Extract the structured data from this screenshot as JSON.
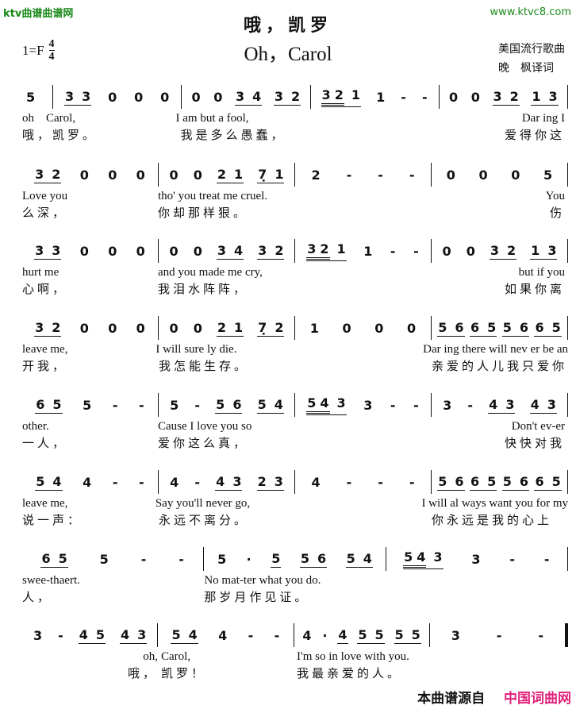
{
  "watermark": {
    "left": "ktv曲谱曲谱网",
    "right": "www.ktvc8.com",
    "color": "#1a8a1a"
  },
  "header": {
    "title_zh": "哦，凯罗",
    "title_en": "Oh，Carol",
    "key": "1=F",
    "time_top": "4",
    "time_bottom": "4",
    "origin": "美国流行歌曲",
    "lyricist": "晚　枫译词"
  },
  "rows": [
    {
      "measures": [
        {
          "notes": "5",
          "en": "oh",
          "zh": "哦，",
          "pickup": true
        },
        {
          "notes": "[3 3] 0 0 0",
          "en": "Carol,",
          "zh": "凯罗。"
        },
        {
          "notes": "0 0 [3 4] [3 2]",
          "en": "I am but a fool,",
          "zh": "我是多么愚蠢，"
        },
        {
          "notes": "[[3 2] 1] 1 - -",
          "en": "",
          "zh": ""
        },
        {
          "notes": "0 0 [3 2] [1 3]",
          "en": "Dar ing I",
          "zh": "爱得你这",
          "align": "right"
        }
      ]
    },
    {
      "measures": [
        {
          "notes": "[3 2] 0 0 0",
          "en": "Love you",
          "zh": "么深，"
        },
        {
          "notes": "0 0 [2 1] [7̣ 1]",
          "en": "tho' you treat me cruel.",
          "zh": "你却那样狠。"
        },
        {
          "notes": "2 - - -",
          "en": "",
          "zh": ""
        },
        {
          "notes": "0 0 0 5",
          "en": "You",
          "zh": "伤",
          "align": "right"
        }
      ]
    },
    {
      "measures": [
        {
          "notes": "[3 3] 0 0 0",
          "en": "hurt me",
          "zh": "心啊，"
        },
        {
          "notes": "0 0 [3 4] [3 2]",
          "en": "and you made me cry,",
          "zh": "我泪水阵阵，"
        },
        {
          "notes": "[[3 2] 1] 1 - -",
          "en": "",
          "zh": ""
        },
        {
          "notes": "0 0 [3 2] [1 3]",
          "en": "but if you",
          "zh": "如果你离",
          "align": "right"
        }
      ]
    },
    {
      "measures": [
        {
          "notes": "[3 2] 0 0 0",
          "en": "leave me,",
          "zh": "开我，"
        },
        {
          "notes": "0 0 [2 1] [7̣ 2]",
          "en": "I will sure ly die.",
          "zh": "我怎能生存。"
        },
        {
          "notes": "1 0 0 0",
          "en": "",
          "zh": ""
        },
        {
          "notes": "[5 6] [6 5] [5 6] [6 5]",
          "en": "Dar ing there will nev er be an",
          "zh": "亲爱的人儿我只爱你"
        }
      ]
    },
    {
      "measures": [
        {
          "notes": "[6 5] 5 - -",
          "en": "other.",
          "zh": "一人，"
        },
        {
          "notes": "5 - [5 6] [5 4]",
          "en": "Cause I love you so",
          "zh": "爱你这么真，"
        },
        {
          "notes": "[[5 4] 3] 3 - -",
          "en": "",
          "zh": ""
        },
        {
          "notes": "3 - [4 3] [4 3]",
          "en": "Don't ev-er",
          "zh": "快快对我",
          "align": "right"
        }
      ]
    },
    {
      "measures": [
        {
          "notes": "[5 4] 4 - -",
          "en": "leave me,",
          "zh": "说一声："
        },
        {
          "notes": "4 - [4 3] [2 3]",
          "en": "Say you'll never go,",
          "zh": "永远不离分。"
        },
        {
          "notes": "4 - - -",
          "en": "",
          "zh": ""
        },
        {
          "notes": "[5 6] [6 5] [5 6] [6 5]",
          "en": "I will al ways want you for my",
          "zh": "你永远是我的心上"
        }
      ]
    },
    {
      "measures": [
        {
          "notes": "[6 5] 5 - -",
          "en": "swee-thaert.",
          "zh": "人，"
        },
        {
          "notes": "5 · [5] [5 6] [5 4]",
          "en": "No mat-ter what you do.",
          "zh": "那岁月作见证。"
        },
        {
          "notes": "[[5 4] 3] 3 - -",
          "en": "",
          "zh": ""
        }
      ]
    },
    {
      "measures": [
        {
          "notes": "3 - [4 5] [4 3]",
          "en": "oh,",
          "zh": "哦，",
          "align": "right"
        },
        {
          "notes": "[5 4] 4 - -",
          "en": "Carol,",
          "zh": "凯罗！"
        },
        {
          "notes": "4 · [4] [5 5] [5 5]",
          "en": "I'm so in love with you.",
          "zh": "我最亲爱的人。"
        },
        {
          "notes": "3 - -",
          "en": "",
          "zh": "",
          "final": true
        }
      ]
    }
  ],
  "footer": {
    "source_label": "本曲谱源自",
    "site": "中国词曲网",
    "site_color": "#e0207a"
  }
}
